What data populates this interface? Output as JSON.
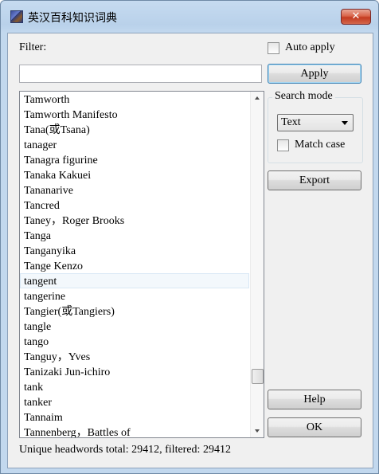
{
  "window": {
    "title": "英汉百科知识词典",
    "close_label": "✕"
  },
  "filter": {
    "label": "Filter:",
    "value": "",
    "placeholder": ""
  },
  "auto_apply": {
    "label": "Auto apply",
    "checked": false
  },
  "apply_button": {
    "label": "Apply"
  },
  "search_mode": {
    "group_label": "Search mode",
    "selected": "Text",
    "match_case": {
      "label": "Match case",
      "checked": false
    }
  },
  "export_button": {
    "label": "Export"
  },
  "help_button": {
    "label": "Help"
  },
  "ok_button": {
    "label": "OK"
  },
  "list": {
    "selected_index": 12,
    "items": [
      "Tamworth",
      "Tamworth Manifesto",
      "Tana(或Tsana)",
      "tanager",
      "Tanagra figurine",
      "Tanaka Kakuei",
      "Tananarive",
      "Tancred",
      "Taney，Roger Brooks",
      "Tanga",
      "Tanganyika",
      "Tange Kenzo",
      "tangent",
      "tangerine",
      "Tangier(或Tangiers)",
      "tangle",
      "tango",
      "Tanguy，Yves",
      "Tanizaki Jun-ichiro",
      "tank",
      "tanker",
      "Tannaim",
      "Tannenberg，Battles of"
    ]
  },
  "status": {
    "text": "Unique headwords total: 29412, filtered: 29412"
  }
}
